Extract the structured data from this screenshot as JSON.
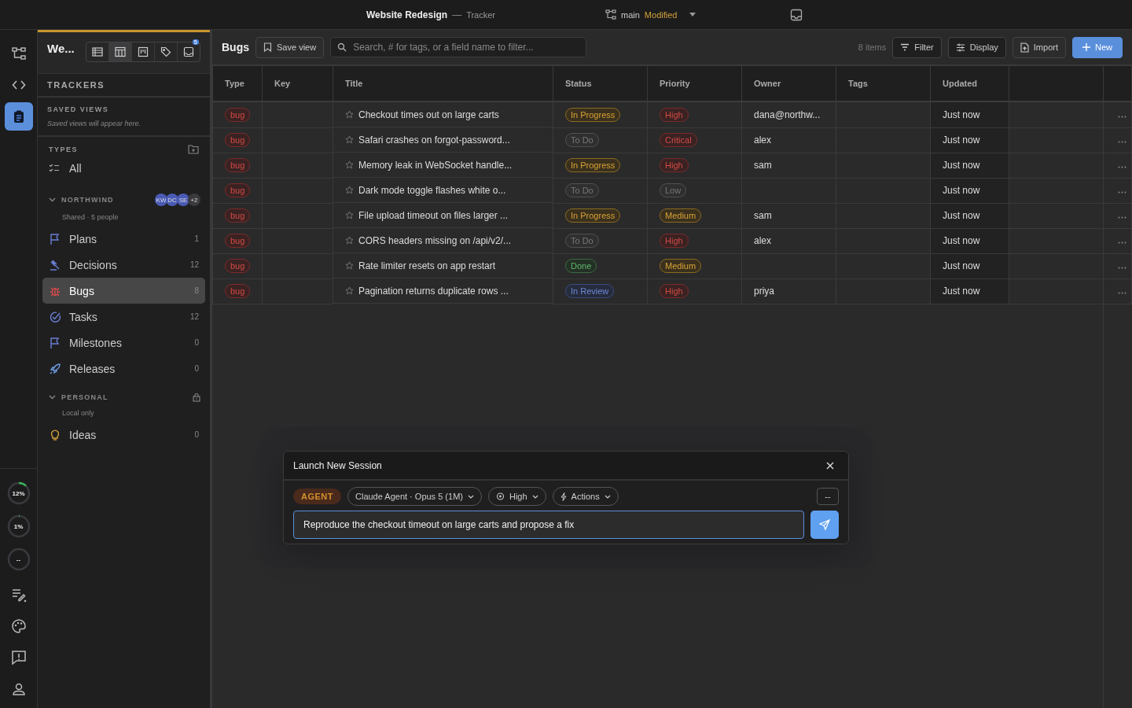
{
  "topbar": {
    "project": "Website Redesign",
    "separator": "—",
    "section": "Tracker",
    "branch": "main",
    "branch_state": "Modified"
  },
  "rail": {
    "items": [
      {
        "kind": "graph",
        "selected": false
      },
      {
        "kind": "code",
        "selected": false
      },
      {
        "kind": "clipboard",
        "selected": true
      }
    ],
    "gauges": [
      {
        "reading": "12%",
        "level": 0.12
      },
      {
        "reading": "1%",
        "level": 0.01
      },
      {
        "reading": "--"
      }
    ]
  },
  "sidebar": {
    "title": "We...",
    "views": [
      {
        "kind": "list",
        "selected": false
      },
      {
        "kind": "table",
        "selected": true
      },
      {
        "kind": "board",
        "selected": false
      },
      {
        "kind": "tag",
        "selected": false
      },
      {
        "kind": "inbox",
        "selected": false,
        "badge": "5"
      }
    ],
    "trackers_heading": "TRACKERS",
    "saved_heading": "SAVED VIEWS",
    "saved_hint": "Saved views will appear here.",
    "types_heading": "TYPES",
    "all_label": "All",
    "groups": [
      {
        "name": "NORTHWIND",
        "expanded": true,
        "subtitle": "Shared · 5 people",
        "avatars": [
          {
            "initials": "KW",
            "color": "#4a5bb5"
          },
          {
            "initials": "DC",
            "color": "#4a5bb5"
          },
          {
            "initials": "SE",
            "color": "#4a5bb5"
          },
          {
            "initials": "+2",
            "color": "#3a3a3e"
          }
        ],
        "locked": false,
        "items": [
          {
            "kind": "flag",
            "label": "Plans",
            "count": "1",
            "selected": false
          },
          {
            "kind": "gavel",
            "label": "Decisions",
            "count": "12",
            "selected": false
          },
          {
            "kind": "bug",
            "label": "Bugs",
            "count": "8",
            "selected": true
          },
          {
            "kind": "check",
            "label": "Tasks",
            "count": "12",
            "selected": false
          },
          {
            "kind": "flag",
            "label": "Milestones",
            "count": "0",
            "selected": false
          },
          {
            "kind": "rocket",
            "label": "Releases",
            "count": "0",
            "selected": false
          }
        ]
      },
      {
        "name": "PERSONAL",
        "expanded": true,
        "subtitle": "Local only",
        "locked": true,
        "items": [
          {
            "kind": "bulb",
            "label": "Ideas",
            "count": "0",
            "selected": false
          }
        ]
      }
    ]
  },
  "toolbar": {
    "title": "Bugs",
    "save_view": "Save view",
    "search_placeholder": "Search, # for tags, or a field name to filter...",
    "count": "8 items",
    "filter": "Filter",
    "display": "Display",
    "import": "Import",
    "new": "New"
  },
  "table": {
    "columns": [
      "Type",
      "Key",
      "Title",
      "Status",
      "Priority",
      "Owner",
      "Tags",
      "Updated"
    ],
    "rows": [
      {
        "type": "bug",
        "title": "Checkout times out on large carts",
        "status": {
          "label": "In Progress",
          "kind": "progress"
        },
        "priority": {
          "label": "High",
          "kind": "high"
        },
        "owner": "dana@northw...",
        "updated": "Just now"
      },
      {
        "type": "bug",
        "title": "Safari crashes on forgot-password...",
        "status": {
          "label": "To Do",
          "kind": "todo"
        },
        "priority": {
          "label": "Critical",
          "kind": "high"
        },
        "owner": "alex",
        "updated": "Just now"
      },
      {
        "type": "bug",
        "title": "Memory leak in WebSocket handle...",
        "status": {
          "label": "In Progress",
          "kind": "progress"
        },
        "priority": {
          "label": "High",
          "kind": "high"
        },
        "owner": "sam",
        "updated": "Just now"
      },
      {
        "type": "bug",
        "title": "Dark mode toggle flashes white o...",
        "status": {
          "label": "To Do",
          "kind": "todo"
        },
        "priority": {
          "label": "Low",
          "kind": "low"
        },
        "updated": "Just now"
      },
      {
        "type": "bug",
        "title": "File upload timeout on files larger ...",
        "status": {
          "label": "In Progress",
          "kind": "progress"
        },
        "priority": {
          "label": "Medium",
          "kind": "medium"
        },
        "owner": "sam",
        "updated": "Just now"
      },
      {
        "type": "bug",
        "title": "CORS headers missing on /api/v2/...",
        "status": {
          "label": "To Do",
          "kind": "todo"
        },
        "priority": {
          "label": "High",
          "kind": "high"
        },
        "owner": "alex",
        "updated": "Just now"
      },
      {
        "type": "bug",
        "title": "Rate limiter resets on app restart",
        "status": {
          "label": "Done",
          "kind": "done"
        },
        "priority": {
          "label": "Medium",
          "kind": "medium"
        },
        "updated": "Just now"
      },
      {
        "type": "bug",
        "title": "Pagination returns duplicate rows ...",
        "status": {
          "label": "In Review",
          "kind": "review"
        },
        "priority": {
          "label": "High",
          "kind": "high"
        },
        "owner": "priya",
        "updated": "Just now"
      }
    ]
  },
  "dialog": {
    "title": "Launch New Session",
    "agent_tag": "AGENT",
    "model": "Claude Agent · Opus 5 (1M)",
    "effort": "High",
    "actions": "Actions",
    "extra": "--",
    "prompt": "Reproduce the checkout timeout on large carts and propose a fix"
  }
}
